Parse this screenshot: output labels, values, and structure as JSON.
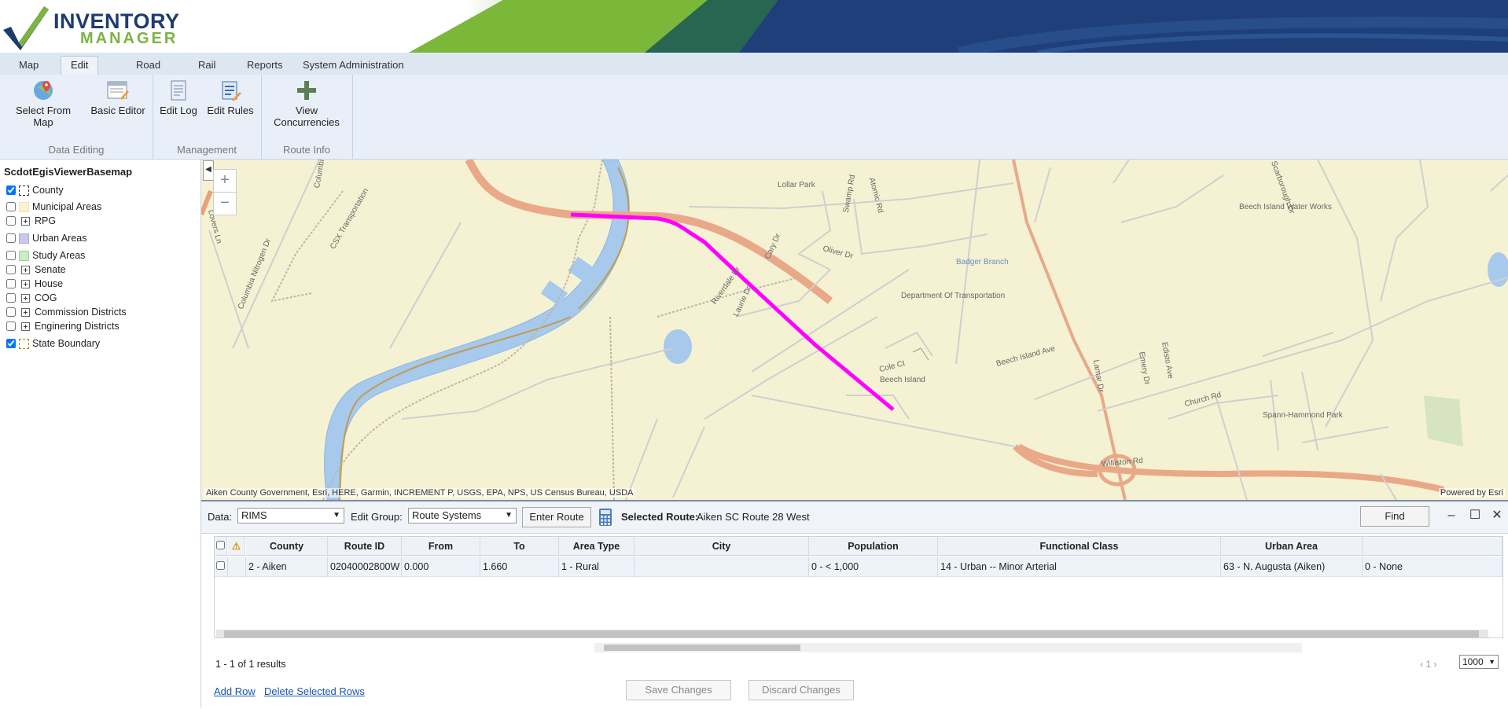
{
  "header": {
    "brand_line1": "INVENTORY",
    "brand_line2": "MANAGER",
    "logo_icon": "checkmark-road-logo-icon"
  },
  "tabs": [
    {
      "label": "Map",
      "active": false
    },
    {
      "label": "Edit",
      "active": true
    },
    {
      "label": "Road",
      "active": false
    },
    {
      "label": "Rail",
      "active": false
    },
    {
      "label": "Reports",
      "active": false
    },
    {
      "label": "System Administration",
      "active": false
    }
  ],
  "ribbon": {
    "groups": [
      {
        "label": "Data Editing",
        "buttons": [
          {
            "label": "Select From Map",
            "icon": "map-pin-icon"
          },
          {
            "label": "Basic Editor",
            "icon": "editor-window-icon"
          }
        ]
      },
      {
        "label": "Management",
        "buttons": [
          {
            "label": "Edit Log",
            "icon": "edit-log-icon"
          },
          {
            "label": "Edit Rules",
            "icon": "edit-rules-icon"
          }
        ]
      },
      {
        "label": "Route Info",
        "buttons": [
          {
            "label": "View Concurrencies",
            "icon": "plus-cross-icon"
          }
        ]
      }
    ]
  },
  "layers": {
    "title": "ScdotEgisViewerBasemap",
    "items": [
      {
        "label": "County",
        "checked": true,
        "symbol": "dashed-box"
      },
      {
        "label": "Municipal Areas",
        "checked": false,
        "symbol": "fill",
        "color": "#fdf2cf"
      },
      {
        "label": "RPG",
        "checked": false,
        "symbol": "expand"
      },
      {
        "label": "Urban Areas",
        "checked": false,
        "symbol": "fill",
        "color": "#c9c9f0"
      },
      {
        "label": "Study Areas",
        "checked": false,
        "symbol": "fill",
        "color": "#c9ecc9"
      },
      {
        "label": "Senate",
        "checked": false,
        "symbol": "expand"
      },
      {
        "label": "House",
        "checked": false,
        "symbol": "expand"
      },
      {
        "label": "COG",
        "checked": false,
        "symbol": "expand"
      },
      {
        "label": "Commission Districts",
        "checked": false,
        "symbol": "expand"
      },
      {
        "label": "Enginering Districts",
        "checked": false,
        "symbol": "expand"
      },
      {
        "label": "State Boundary",
        "checked": true,
        "symbol": "dashed-box-gold"
      }
    ]
  },
  "map": {
    "attribution": "Aiken County Government, Esri, HERE, Garmin, INCREMENT P, USGS, EPA, NPS, US Census Bureau, USDA",
    "powered_by": "Powered by Esri",
    "zoom_in": "+",
    "zoom_out": "−",
    "labels": [
      "Lollar Park",
      "Swamp Rd",
      "Atomic Rd",
      "Oliver Dr",
      "Badger Branch",
      "Department Of Transportation",
      "Riverdale Dr",
      "Laurie Dr",
      "Cary Dr",
      "Cole Ct",
      "Beech Island",
      "Beech Island Ave",
      "Lamar Dr",
      "Emery Dr",
      "Edisto Ave",
      "Church Rd",
      "Williston Rd",
      "Beech Island Water Works",
      "Spann-Hammond Park",
      "Scarborough Dr",
      "Lovers Ln",
      "Columbia Nitrogen Dr",
      "CSX Transportation",
      "Columbia"
    ],
    "route_color": "#ff00ff"
  },
  "grid": {
    "data_label": "Data:",
    "data_value": "RIMS",
    "edit_group_label": "Edit Group:",
    "edit_group_value": "Route Systems",
    "enter_route": "Enter Route",
    "selected_route_label": "Selected Route:",
    "selected_route_value": "Aiken SC Route 28 West",
    "find": "Find",
    "columns": [
      "County",
      "Route ID",
      "From",
      "To",
      "Area Type",
      "City",
      "Population",
      "Functional Class",
      "Urban Area"
    ],
    "rows": [
      [
        "2 - Aiken",
        "02040002800W",
        "0.000",
        "1.660",
        "1 - Rural",
        "",
        "0 - < 1,000",
        "14 - Urban -- Minor Arterial",
        "63 - N. Augusta (Aiken)",
        "0 - None"
      ]
    ],
    "results_text": "1 - 1 of 1 results",
    "page_number": "1",
    "page_size": "1000",
    "add_row": "Add Row",
    "delete_rows": "Delete Selected Rows",
    "save_changes": "Save Changes",
    "discard_changes": "Discard Changes"
  }
}
